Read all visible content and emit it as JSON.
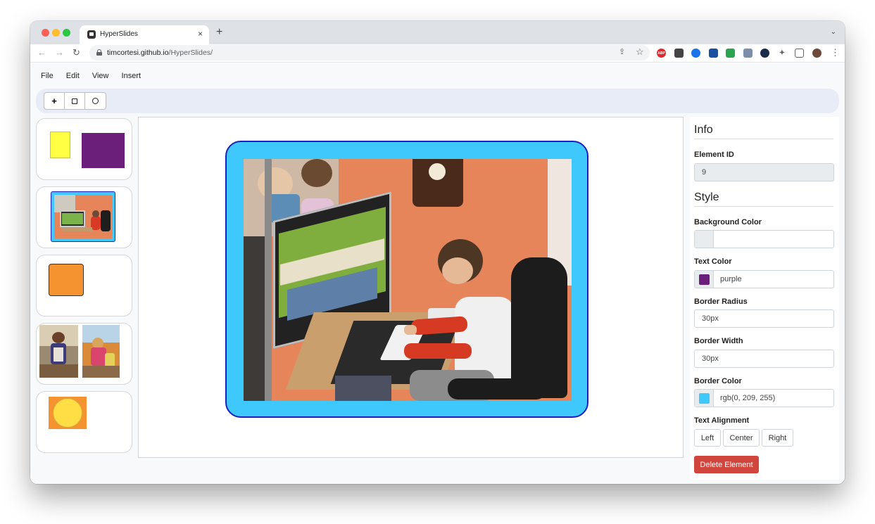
{
  "browser": {
    "tab_title": "HyperSlides",
    "tab_close": "×",
    "new_tab": "+",
    "tabs_menu": "⌄",
    "url_host": "timcortesi.github.io",
    "url_path": "/HyperSlides/",
    "nav": {
      "back": "←",
      "forward": "→",
      "reload": "↻"
    },
    "omni_icons": {
      "share": "⇪",
      "bookmark": "☆"
    },
    "menu": "⋮",
    "extensions": [
      {
        "name": "adblock-icon",
        "color": "#e0282e",
        "label": "ABP"
      },
      {
        "name": "qr-icon",
        "color": "#444444",
        "label": ""
      },
      {
        "name": "circle-ext-icon",
        "color": "#1a73e8",
        "label": ""
      },
      {
        "name": "bookmark-ext-icon",
        "color": "#1b4fa0",
        "label": ""
      },
      {
        "name": "grammar-ext-icon",
        "color": "#2aa44f",
        "label": ""
      },
      {
        "name": "grey-ext-icon",
        "color": "#7d8fa8",
        "label": ""
      },
      {
        "name": "dark-ext-icon",
        "color": "#1a2b4a",
        "label": ""
      },
      {
        "name": "puzzle-icon",
        "color": "#5f6368",
        "label": "✦"
      },
      {
        "name": "sidepanel-icon",
        "color": "#5f6368",
        "label": ""
      },
      {
        "name": "profile-avatar",
        "color": "#6b4a3a",
        "label": ""
      }
    ]
  },
  "app": {
    "menu": [
      "File",
      "Edit",
      "View",
      "Insert"
    ],
    "shape_buttons": {
      "add": "+"
    }
  },
  "panel": {
    "info_heading": "Info",
    "element_id_label": "Element ID",
    "element_id_value": "9",
    "style_heading": "Style",
    "bg_color_label": "Background Color",
    "bg_color_value": "",
    "text_color_label": "Text Color",
    "text_color_value": "purple",
    "text_color_swatch": "#6b1f7a",
    "border_radius_label": "Border Radius",
    "border_radius_value": "30px",
    "border_width_label": "Border Width",
    "border_width_value": "30px",
    "border_color_label": "Border Color",
    "border_color_value": "rgb(0, 209, 255)",
    "border_color_swatch": "#3fc8fb",
    "text_align_label": "Text Alignment",
    "align": [
      "Left",
      "Center",
      "Right"
    ],
    "delete_label": "Delete Element"
  },
  "colors": {
    "accent_blue": "#3fc8fb",
    "frame_border": "#1d1fbf",
    "yellow": "#ffff44",
    "purple": "#6b1f7a",
    "orange": "#f59331",
    "circle_yellow": "#ffdd44",
    "delete_red": "#d0463c"
  }
}
